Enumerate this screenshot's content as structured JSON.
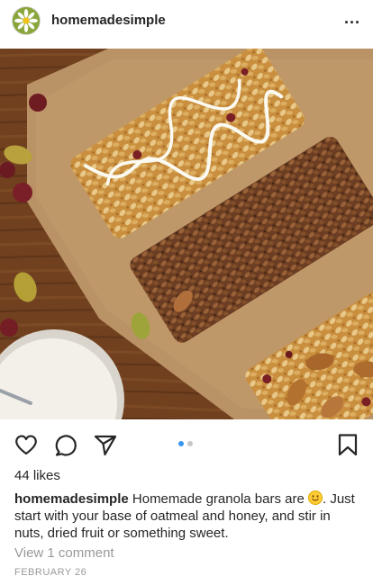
{
  "post": {
    "username": "homemadesimple",
    "more_label": "...",
    "likes": "44 likes",
    "caption": {
      "username": "homemadesimple",
      "text_before_emoji": "Homemade granola bars are",
      "text_after_emoji": ". Just start with your base of oatmeal and honey, and stir in nuts, dried fruit or something sweet."
    },
    "view_comments": "View 1 comment",
    "date": "FEBRUARY 26"
  },
  "carousel": {
    "count": 2,
    "active_index": 0
  },
  "icons": {
    "avatar": "daisy-avatar-icon",
    "like": "heart-icon",
    "comment": "comment-icon",
    "share": "send-icon",
    "save": "bookmark-icon"
  },
  "colors": {
    "text": "#262626",
    "muted": "#999999",
    "accent": "#3897f0"
  }
}
